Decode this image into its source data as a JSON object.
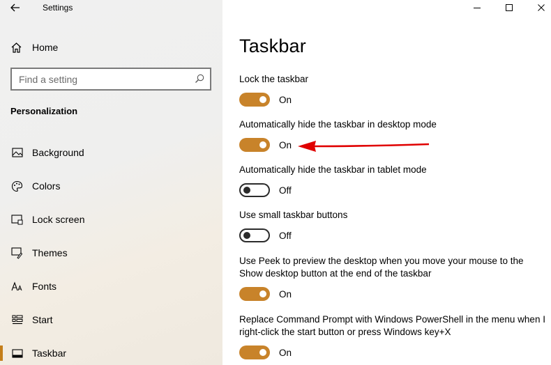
{
  "window": {
    "title": "Settings",
    "controls": {
      "minimize_icon": "minimize-icon",
      "maximize_icon": "maximize-icon",
      "close_icon": "close-icon"
    }
  },
  "sidebar": {
    "home_label": "Home",
    "search": {
      "placeholder": "Find a setting",
      "value": ""
    },
    "section_title": "Personalization",
    "items": [
      {
        "label": "Background",
        "icon": "picture-icon"
      },
      {
        "label": "Colors",
        "icon": "palette-icon"
      },
      {
        "label": "Lock screen",
        "icon": "lock-screen-icon"
      },
      {
        "label": "Themes",
        "icon": "brush-icon"
      },
      {
        "label": "Fonts",
        "icon": "font-icon"
      },
      {
        "label": "Start",
        "icon": "start-icon"
      },
      {
        "label": "Taskbar",
        "icon": "taskbar-icon",
        "selected": true
      }
    ]
  },
  "main": {
    "title": "Taskbar",
    "settings": [
      {
        "label": "Lock the taskbar",
        "state": "On",
        "on": true
      },
      {
        "label": "Automatically hide the taskbar in desktop mode",
        "state": "On",
        "on": true
      },
      {
        "label": "Automatically hide the taskbar in tablet mode",
        "state": "Off",
        "on": false
      },
      {
        "label": "Use small taskbar buttons",
        "state": "Off",
        "on": false
      },
      {
        "label": "Use Peek to preview the desktop when you move your mouse to the Show desktop button at the end of the taskbar",
        "state": "On",
        "on": true
      },
      {
        "label": "Replace Command Prompt with Windows PowerShell in the menu when I right-click the start button or press Windows key+X",
        "state": "On",
        "on": true
      }
    ]
  },
  "colors": {
    "accent": "#c8832a",
    "annotation_arrow": "#e00000"
  }
}
